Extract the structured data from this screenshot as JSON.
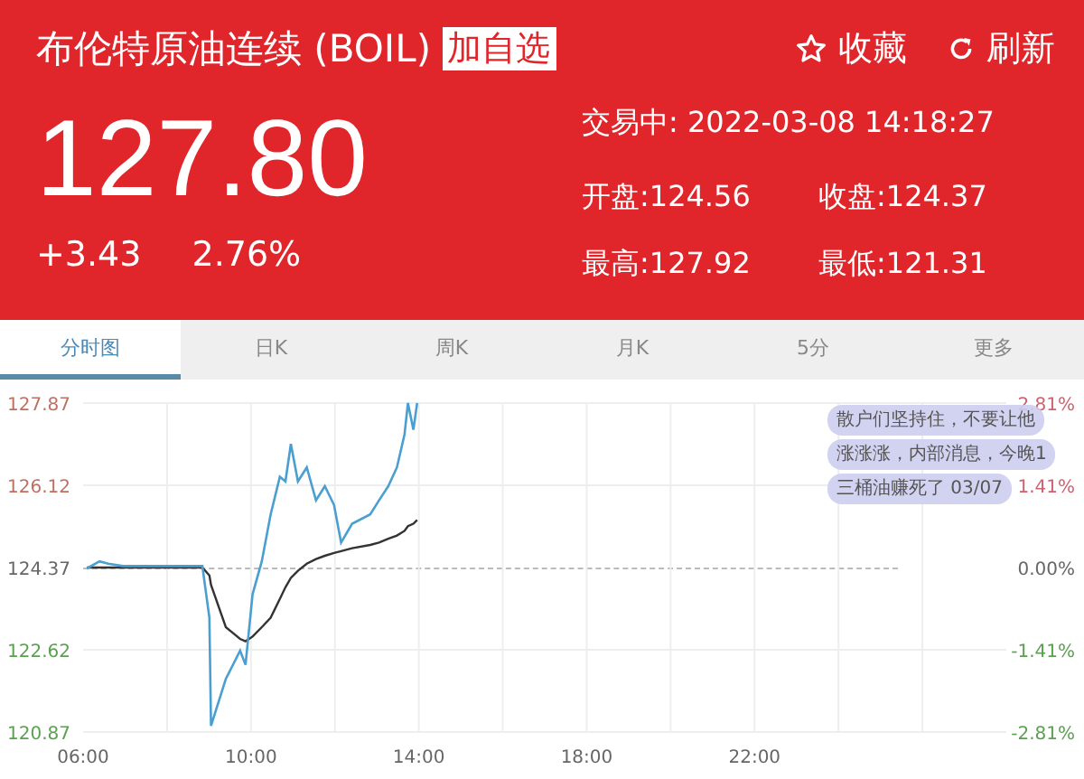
{
  "header": {
    "title": "布伦特原油连续 (BOIL)",
    "add_button": "加自选",
    "actions": [
      {
        "kind": "star",
        "label": "收藏"
      },
      {
        "kind": "refresh",
        "label": "刷新"
      }
    ],
    "price": "127.80",
    "change": "+3.43",
    "change_pct": "2.76%",
    "status": "交易中: 2022-03-08 14:18:27",
    "stats": [
      {
        "label": "开盘:124.56"
      },
      {
        "label": "收盘:124.37"
      },
      {
        "label": "最高:127.92"
      },
      {
        "label": "最低:121.31"
      }
    ]
  },
  "tabs": [
    {
      "label": "分时图",
      "selected": true
    },
    {
      "label": "日K",
      "selected": false
    },
    {
      "label": "周K",
      "selected": false
    },
    {
      "label": "月K",
      "selected": false
    },
    {
      "label": "5分",
      "selected": false
    },
    {
      "label": "更多",
      "selected": false
    }
  ],
  "chart": {
    "chart_data": {
      "type": "line",
      "x": [
        6.09,
        6.39,
        6.6,
        6.95,
        7.89,
        8.84,
        9.01,
        9.05,
        9.4,
        9.74,
        9.87,
        10.04,
        10.26,
        10.47,
        10.69,
        10.82,
        10.95,
        11.12,
        11.33,
        11.55,
        11.76,
        11.98,
        12.15,
        12.41,
        12.84,
        13.05,
        13.27,
        13.48,
        13.66,
        13.74,
        13.87,
        13.96
      ],
      "series": [
        {
          "color": "#4a9fd0",
          "values": [
            124.35,
            124.5,
            124.45,
            124.4,
            124.4,
            124.4,
            123.3,
            121.0,
            122.0,
            122.6,
            122.3,
            123.8,
            124.5,
            125.5,
            126.3,
            126.2,
            127.0,
            126.2,
            126.5,
            125.8,
            126.1,
            125.7,
            124.9,
            125.3,
            125.5,
            125.8,
            126.1,
            126.5,
            127.2,
            127.87,
            127.3,
            127.87
          ]
        },
        {
          "color": "#333333",
          "values": [
            124.37,
            124.37,
            124.37,
            124.37,
            124.37,
            124.37,
            124.2,
            124.0,
            123.1,
            122.85,
            122.8,
            122.9,
            123.1,
            123.3,
            123.7,
            123.95,
            124.15,
            124.3,
            124.45,
            124.55,
            124.62,
            124.68,
            124.72,
            124.78,
            124.85,
            124.9,
            124.98,
            125.05,
            125.15,
            125.25,
            125.3,
            125.38
          ]
        }
      ],
      "grid": true,
      "xlim": [
        6,
        28
      ],
      "ylim": [
        120.87,
        127.87
      ],
      "xticks": [
        {
          "value": 6,
          "label": "06:00"
        },
        {
          "value": 10,
          "label": "10:00"
        },
        {
          "value": 14,
          "label": "14:00"
        },
        {
          "value": 18,
          "label": "18:00"
        },
        {
          "value": 22,
          "label": "22:00"
        }
      ],
      "yticks": [
        120.87,
        122.62,
        124.37,
        126.12,
        127.87
      ]
    },
    "right_labels": [
      "2.81%",
      "1.41%",
      "0.00%",
      "-1.41%",
      "-2.81%"
    ],
    "comments": [
      "散户们坚持住，不要让他",
      "涨涨涨，内部消息，今晚1",
      "三桶油赚死了 03/07"
    ]
  }
}
